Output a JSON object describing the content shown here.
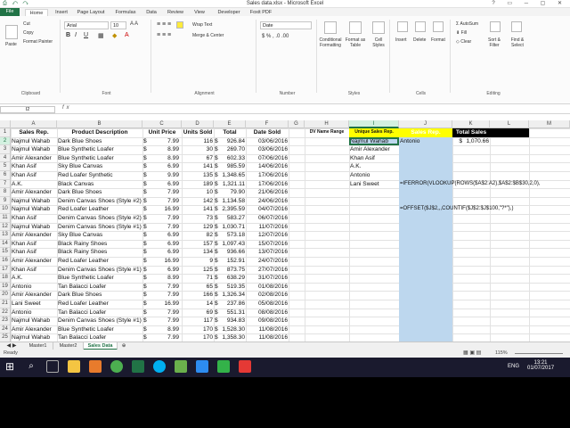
{
  "window": {
    "title": "Sales data.xlsx - Microsoft Excel",
    "quick_access": "⎙ ↶ ↷"
  },
  "tabs": [
    "File",
    "Home",
    "Insert",
    "Page Layout",
    "Formulas",
    "Data",
    "Review",
    "View",
    "Developer",
    "Foxit PDF"
  ],
  "ribbon": {
    "clipboard": {
      "paste": "Paste",
      "cut": "Cut",
      "copy": "Copy",
      "painter": "Format Painter",
      "label": "Clipboard"
    },
    "font": {
      "name": "Arial",
      "size": "10",
      "label": "Font"
    },
    "alignment": {
      "wrap": "Wrap Text",
      "merge": "Merge & Center",
      "label": "Alignment"
    },
    "number": {
      "format": "Date",
      "label": "Number"
    },
    "styles": {
      "cond": "Conditional Formatting",
      "table": "Format as Table",
      "cell": "Cell Styles",
      "label": "Styles"
    },
    "cells": {
      "insert": "Insert",
      "delete": "Delete",
      "format": "Format",
      "label": "Cells"
    },
    "editing": {
      "autosum": "AutoSum",
      "fill": "Fill",
      "clear": "Clear",
      "sort": "Sort & Filter",
      "find": "Find & Select",
      "label": "Editing"
    }
  },
  "formula_bar": {
    "name_box": "I2",
    "fx": "fx",
    "value": ""
  },
  "columns": [
    "A",
    "B",
    "C",
    "D",
    "E",
    "F",
    "G",
    "H",
    "I",
    "J",
    "K",
    "L",
    "M",
    "N"
  ],
  "header_row": [
    "Sales Rep.",
    "Product Description",
    "Unit Price",
    "Units Sold",
    "Total",
    "Date Sold"
  ],
  "rows": [
    [
      "Najmul Wahab",
      "Dark Blue Shoes",
      "$",
      "7.99",
      "116",
      "$",
      "926.84",
      "03/06/2016"
    ],
    [
      "Najmul Wahab",
      "Blue Synthetic Loafer",
      "$",
      "8.99",
      "30",
      "$",
      "269.70",
      "03/06/2016"
    ],
    [
      "Amir Alexander",
      "Blue Synthetic Loafer",
      "$",
      "8.99",
      "67",
      "$",
      "602.33",
      "07/06/2016"
    ],
    [
      "Khan Asif",
      "Sky Blue Canvas",
      "$",
      "6.99",
      "141",
      "$",
      "985.59",
      "14/06/2016"
    ],
    [
      "Khan Asif",
      "Red Loafer Synthetic",
      "$",
      "9.99",
      "135",
      "$",
      "1,348.65",
      "17/06/2016"
    ],
    [
      "A.K.",
      "Black Canvas",
      "$",
      "6.99",
      "189",
      "$",
      "1,321.11",
      "17/06/2016"
    ],
    [
      "Amir Alexander",
      "Dark Blue Shoes",
      "$",
      "7.99",
      "10",
      "$",
      "79.90",
      "21/06/2016"
    ],
    [
      "Najmul Wahab",
      "Denim Canvas Shoes (Style #2)",
      "$",
      "7.99",
      "142",
      "$",
      "1,134.58",
      "24/06/2016"
    ],
    [
      "Najmul Wahab",
      "Red Loafer Leather",
      "$",
      "16.99",
      "141",
      "$",
      "2,395.59",
      "04/07/2016"
    ],
    [
      "Khan Asif",
      "Denim Canvas Shoes (Style #2)",
      "$",
      "7.99",
      "73",
      "$",
      "583.27",
      "06/07/2016"
    ],
    [
      "Najmul Wahab",
      "Denim Canvas Shoes (Style #1)",
      "$",
      "7.99",
      "129",
      "$",
      "1,030.71",
      "11/07/2016"
    ],
    [
      "Amir Alexander",
      "Sky Blue Canvas",
      "$",
      "6.99",
      "82",
      "$",
      "573.18",
      "12/07/2016"
    ],
    [
      "Khan Asif",
      "Black Rainy Shoes",
      "$",
      "6.99",
      "157",
      "$",
      "1,097.43",
      "15/07/2016"
    ],
    [
      "Khan Asif",
      "Black Rainy Shoes",
      "$",
      "6.99",
      "134",
      "$",
      "936.66",
      "13/07/2016"
    ],
    [
      "Amir Alexander",
      "Red Loafer Leather",
      "$",
      "16.99",
      "9",
      "$",
      "152.91",
      "24/07/2016"
    ],
    [
      "Khan Asif",
      "Denim Canvas Shoes (Style #1)",
      "$",
      "6.99",
      "125",
      "$",
      "873.75",
      "27/07/2016"
    ],
    [
      "A.K.",
      "Blue Synthetic Loafer",
      "$",
      "8.99",
      "71",
      "$",
      "638.29",
      "31/07/2016"
    ],
    [
      "Antonio",
      "Tan Balacci Loafer",
      "$",
      "7.99",
      "65",
      "$",
      "519.35",
      "01/08/2016"
    ],
    [
      "Amir Alexander",
      "Dark Blue Shoes",
      "$",
      "7.99",
      "166",
      "$",
      "1,326.34",
      "02/08/2016"
    ],
    [
      "Lani Sweet",
      "Red Loafer Leather",
      "$",
      "16.99",
      "14",
      "$",
      "237.86",
      "05/08/2016"
    ],
    [
      "Antonio",
      "Tan Balacci Loafer",
      "$",
      "7.99",
      "69",
      "$",
      "551.31",
      "08/08/2016"
    ],
    [
      "Najmul Wahab",
      "Denim Canvas Shoes (Style #1)",
      "$",
      "7.99",
      "117",
      "$",
      "934.83",
      "09/08/2016"
    ],
    [
      "Amir Alexander",
      "Blue Synthetic Loafer",
      "$",
      "8.99",
      "170",
      "$",
      "1,528.30",
      "11/08/2016"
    ],
    [
      "Najmul Wahab",
      "Tan Balacci Loafer",
      "$",
      "7.99",
      "170",
      "$",
      "1,358.30",
      "11/08/2016"
    ]
  ],
  "side": {
    "i1": "DV Name Range",
    "j1": "Unique Sales Rep.",
    "k1": "Sales Rep.",
    "l1": "Total Sales",
    "k2": "Antonio",
    "l2_sym": "$",
    "l2": "1,070.66",
    "unique_list": [
      "Najmul Wahab",
      "Amir Alexander",
      "Khan Asif",
      "A.K.",
      "Antonio",
      "Lani Sweet"
    ],
    "formula1": "=IFERROR(VLOOKUP(ROWS($A$2:A2),$A$2:$B$30,2,0),",
    "formula2": "=OFFSET($J$2,,,COUNTIF($J$2:$J$100,\"?*\"),)"
  },
  "sheets": [
    "Master1",
    "Master2",
    "Sales Data"
  ],
  "status": {
    "left": "Ready",
    "zoom": "115%"
  },
  "taskbar": {
    "time": "13:21",
    "date": "01/07/2017",
    "lang": "ENG"
  },
  "colors": {
    "excel_green": "#217346",
    "highlight": "#bdd7ee",
    "header_black": "#000000",
    "yellow": "#ffff00"
  }
}
